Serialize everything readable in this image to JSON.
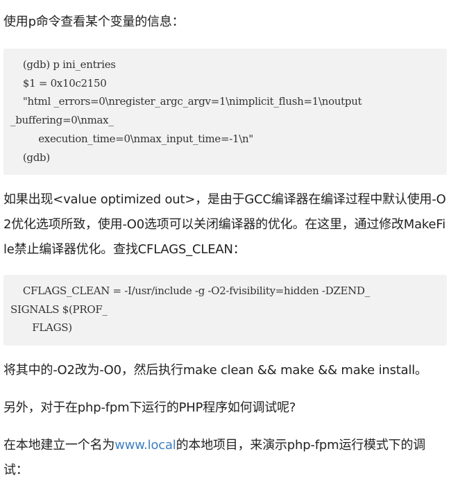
{
  "para1": "使用p命令查看某个变量的信息：",
  "code1": {
    "lines": [
      "    (gdb) p ini_entries",
      "    $1 = 0x10c2150",
      "    \"html _errors=0\\nregister_argc_argv=1\\nimplicit_flush=1\\noutput",
      "_buffering=0\\nmax_",
      "         execution_time=0\\nmax_input_time=-1\\n\"",
      "    (gdb)"
    ]
  },
  "para2": "如果出现<value optimized out>，是由于GCC编译器在编译过程中默认使用-O2优化选项所致，使用-O0选项可以关闭编译器的优化。在这里，通过修改MakeFile禁止编译器优化。查找CFLAGS_CLEAN：",
  "code2": {
    "lines": [
      "    CFLAGS_CLEAN = -I/usr/include -g -O2-fvisibility=hidden -DZEND_",
      "SIGNALS $(PROF_",
      "       FLAGS)"
    ]
  },
  "para3": "将其中的-O2改为-O0，然后执行make clean && make && make install。",
  "para4": "另外，对于在php-fpm下运行的PHP程序如何调试呢?",
  "para5": {
    "before": "在本地建立一个名为",
    "link": "www.local",
    "after": "的本地项目，来演示php-fpm运行模式下的调试："
  }
}
